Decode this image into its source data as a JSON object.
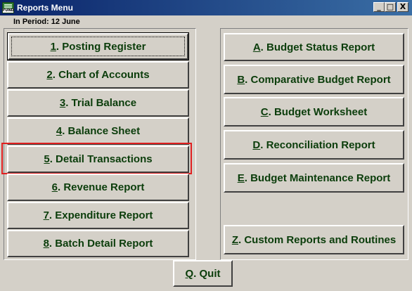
{
  "window": {
    "title": "Reports Menu",
    "icon_label": "FUND",
    "controls": {
      "minimize": "_",
      "maximize": "□",
      "close": "X"
    }
  },
  "period_label": "In Period: 12 June",
  "left_buttons": [
    {
      "key": "1",
      "rest": ".  Posting Register"
    },
    {
      "key": "2",
      "rest": ".  Chart of Accounts"
    },
    {
      "key": "3",
      "rest": ".  Trial Balance"
    },
    {
      "key": "4",
      "rest": ".  Balance Sheet"
    },
    {
      "key": "5",
      "rest": ". Detail Transactions"
    },
    {
      "key": "6",
      "rest": ". Revenue Report"
    },
    {
      "key": "7",
      "rest": ".  Expenditure Report"
    },
    {
      "key": "8",
      "rest": ". Batch Detail Report"
    }
  ],
  "right_buttons": [
    {
      "key": "A",
      "rest": ". Budget Status Report"
    },
    {
      "key": "B",
      "rest": ". Comparative Budget Report"
    },
    {
      "key": "C",
      "rest": ". Budget Worksheet"
    },
    {
      "key": "D",
      "rest": ". Reconciliation Report"
    },
    {
      "key": "E",
      "rest": ". Budget Maintenance Report"
    },
    {
      "key": "Z",
      "rest": ". Custom Reports and Routines"
    }
  ],
  "quit_button": {
    "key": "Q",
    "rest": ".  Quit"
  },
  "highlighted_item": "5"
}
